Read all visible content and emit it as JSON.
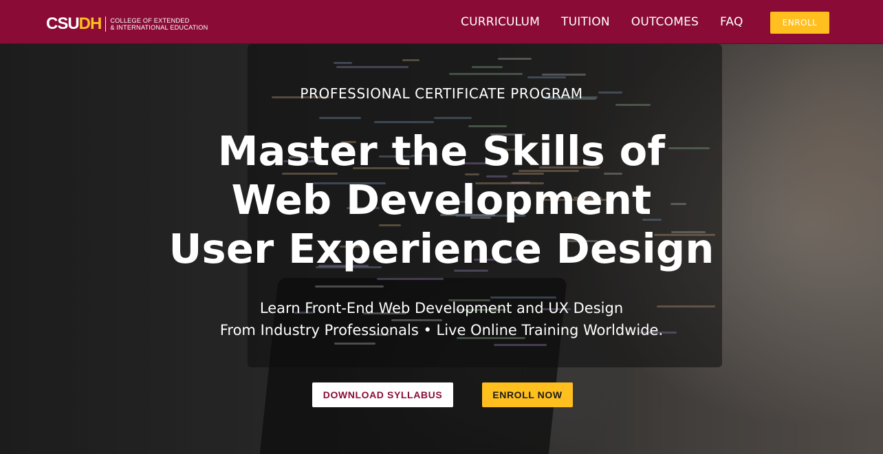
{
  "header": {
    "logo": {
      "mark_main": "CSU",
      "mark_accent": "DH",
      "line1": "COLLEGE OF EXTENDED",
      "line2": "& INTERNATIONAL EDUCATION"
    },
    "nav": [
      {
        "label": "CURRICULUM"
      },
      {
        "label": "TUITION"
      },
      {
        "label": "OUTCOMES"
      },
      {
        "label": "FAQ"
      }
    ],
    "enroll_label": "ENROLL"
  },
  "hero": {
    "eyebrow": "PROFESSIONAL CERTIFICATE PROGRAM",
    "headline": [
      "Master the Skills of",
      "Web Development",
      "User Experience Design"
    ],
    "subhead": [
      "Learn Front-End Web Development and UX Design",
      "From Industry Professionals • Live Online Training Worldwide."
    ],
    "buttons": {
      "syllabus": "DOWNLOAD SYLLABUS",
      "enroll": "ENROLL NOW"
    }
  },
  "colors": {
    "brand": "#8a0c36",
    "accent": "#ffbf1f",
    "text": "#ffffff"
  }
}
